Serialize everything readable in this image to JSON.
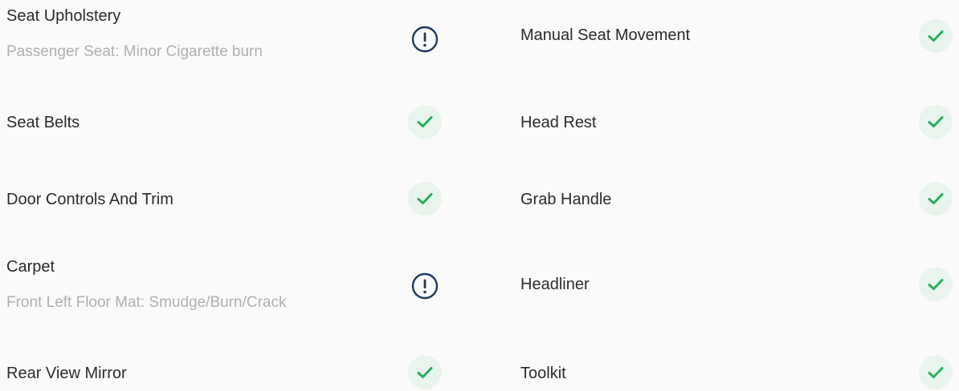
{
  "left": [
    {
      "title": "Seat Upholstery",
      "note": "Passenger Seat: Minor Cigarette burn",
      "status": "warn"
    },
    {
      "title": "Seat Belts",
      "note": "",
      "status": "ok"
    },
    {
      "title": "Door Controls And Trim",
      "note": "",
      "status": "ok"
    },
    {
      "title": "Carpet",
      "note": "Front Left Floor Mat: Smudge/Burn/Crack",
      "status": "warn"
    },
    {
      "title": "Rear View Mirror",
      "note": "",
      "status": "ok"
    }
  ],
  "right": [
    {
      "title": "Manual Seat Movement",
      "status": "ok"
    },
    {
      "title": "Head Rest",
      "status": "ok"
    },
    {
      "title": "Grab Handle",
      "status": "ok"
    },
    {
      "title": "Headliner",
      "status": "ok"
    },
    {
      "title": "Toolkit",
      "status": "ok"
    }
  ],
  "colors": {
    "ok": "#27ae60",
    "warn": "#1e3a5f"
  },
  "icons": {
    "ok": "check-icon",
    "warn": "exclamation-icon"
  }
}
